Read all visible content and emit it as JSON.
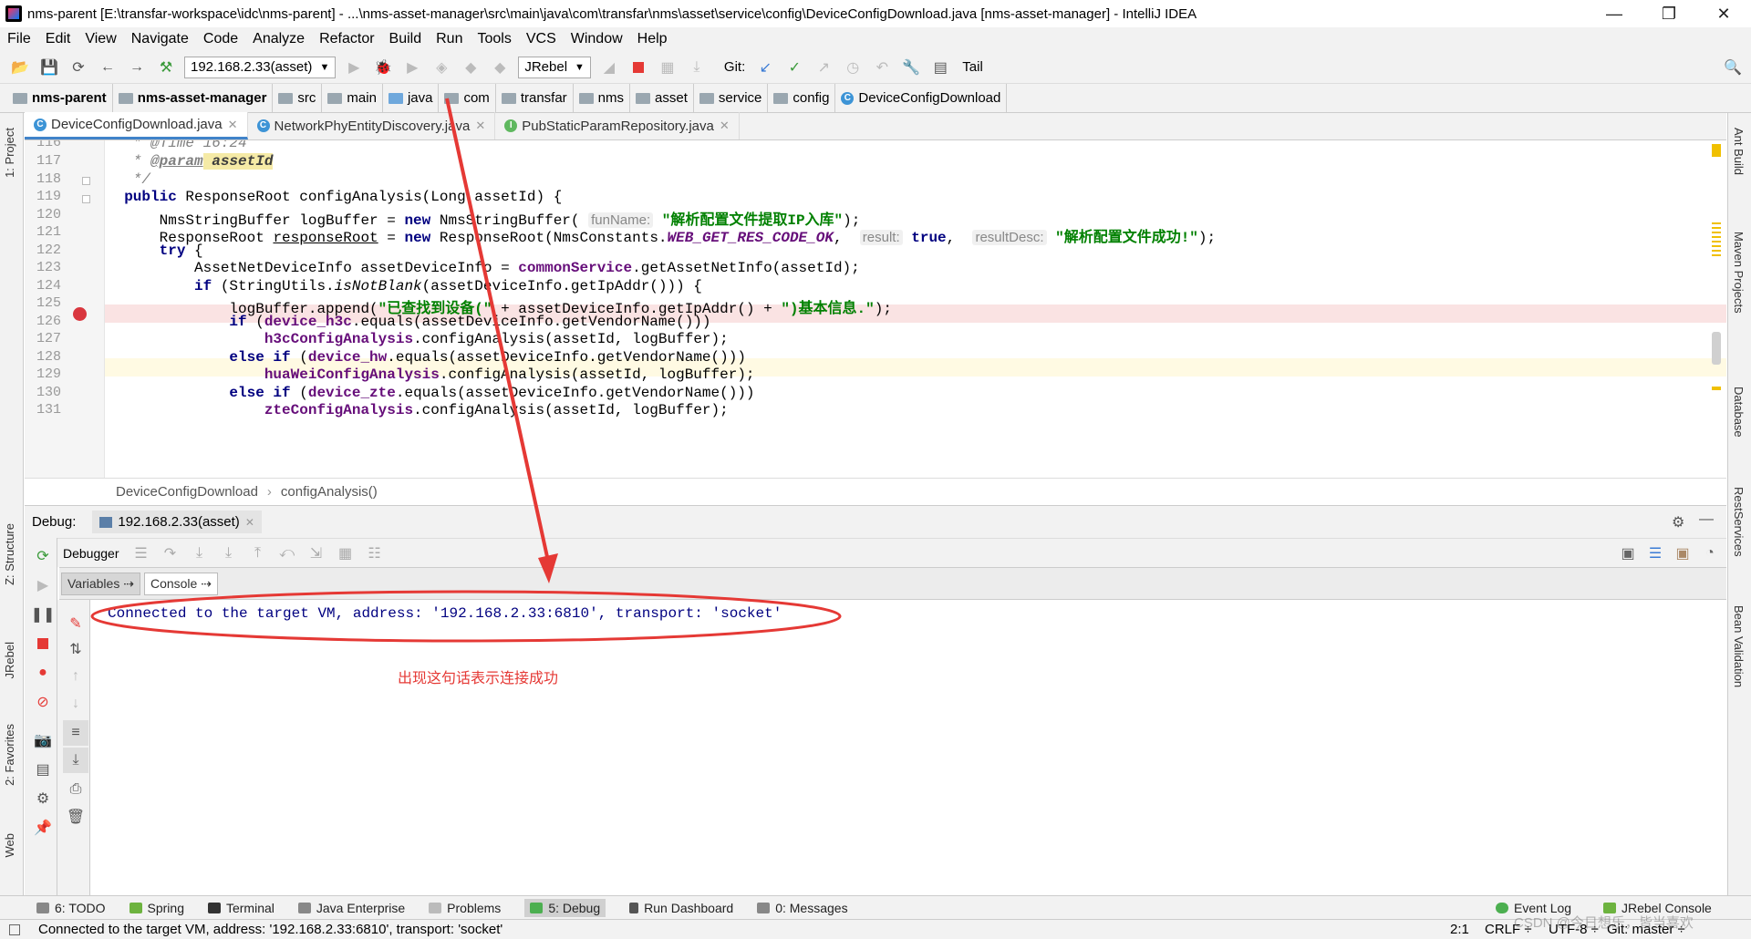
{
  "window": {
    "title": "nms-parent [E:\\transfar-workspace\\idc\\nms-parent] - ...\\nms-asset-manager\\src\\main\\java\\com\\transfar\\nms\\asset\\service\\config\\DeviceConfigDownload.java [nms-asset-manager] - IntelliJ IDEA",
    "minimize": "—",
    "maximize": "❐",
    "close": "✕"
  },
  "menu": [
    "File",
    "Edit",
    "View",
    "Navigate",
    "Code",
    "Analyze",
    "Refactor",
    "Build",
    "Run",
    "Tools",
    "VCS",
    "Window",
    "Help"
  ],
  "toolbar": {
    "run_config": "192.168.2.33(asset)",
    "jrebel": "JRebel",
    "git_label": "Git:",
    "tail": "Tail"
  },
  "nav": [
    "nms-parent",
    "nms-asset-manager",
    "src",
    "main",
    "java",
    "com",
    "transfar",
    "nms",
    "asset",
    "service",
    "config",
    "DeviceConfigDownload"
  ],
  "tabs": [
    "DeviceConfigDownload.java",
    "NetworkPhyEntityDiscovery.java",
    "PubStaticParamRepository.java"
  ],
  "code": {
    "line_numbers": [
      "116",
      "117",
      "118",
      "119",
      "120",
      "121",
      "122",
      "123",
      "124",
      "125",
      "126",
      "127",
      "128",
      "129",
      "130",
      "131"
    ],
    "l116": "   * @Time 16:24",
    "l117a": "   * ",
    "l117b": "@param",
    "l117c": " assetId",
    "l118": "   */",
    "l119a": "  public ",
    "l119b": "ResponseRoot configAnalysis(Long assetId) {",
    "l120a": "      NmsStringBuffer logBuffer = ",
    "l120b": "new",
    "l120c": " NmsStringBuffer( ",
    "l120hint": "funName:",
    "l120d": " \"解析配置文件提取IP入库\"",
    "l120e": ");",
    "l121a": "      ResponseRoot ",
    "l121b": "responseRoot",
    "l121c": " = ",
    "l121d": "new",
    "l121e": " ResponseRoot(NmsConstants.",
    "l121f": "WEB_GET_RES_CODE_OK",
    "l121g": ",  ",
    "l121hint1": "result:",
    "l121h": " true",
    "l121i": ",  ",
    "l121hint2": "resultDesc:",
    "l121j": " \"解析配置文件成功!\"",
    "l121k": ");",
    "l122a": "      ",
    "l122b": "try",
    "l122c": " {",
    "l123a": "          AssetNetDeviceInfo assetDeviceInfo = ",
    "l123b": "commonService",
    "l123c": ".getAssetNetInfo(assetId);",
    "l124a": "          ",
    "l124b": "if",
    "l124c": " (StringUtils.",
    "l124d": "isNotBlank",
    "l124e": "(assetDeviceInfo.getIpAddr())) {",
    "l125a": "              logBuffer.append(",
    "l125b": "\"已查找到设备(\"",
    "l125c": " + assetDeviceInfo.getIpAddr() + ",
    "l125d": "\")基本信息.\"",
    "l125e": ");",
    "l126a": "              ",
    "l126b": "if",
    "l126c": " (",
    "l126d": "device_h3c",
    "l126e": ".equals(assetDeviceInfo.getVendorName()))",
    "l127a": "                  ",
    "l127b": "h3cConfigAnalysis",
    "l127c": ".configAnalysis(assetId, logBuffer);",
    "l128a": "              ",
    "l128b": "else if",
    "l128c": " (",
    "l128d": "device_hw",
    "l128e": ".equals(assetDeviceInfo.getVendorName()))",
    "l129a": "                  ",
    "l129b": "huaWeiConfigAnalysis",
    "l129c": ".configAnalysis(assetId, logBuffer);",
    "l130a": "              ",
    "l130b": "else if",
    "l130c": " (",
    "l130d": "device_zte",
    "l130e": ".equals(assetDeviceInfo.getVendorName()))",
    "l131a": "                  ",
    "l131b": "zteConfigAnalysis",
    "l131c": ".configAnalysis(assetId, logBuffer);"
  },
  "editor_breadcrumb": [
    "DeviceConfigDownload",
    "configAnalysis()"
  ],
  "debug": {
    "label": "Debug:",
    "session": "192.168.2.33(asset)",
    "debugger_tab": "Debugger",
    "variables_tab": "Variables",
    "console_tab": "Console",
    "console_line": "Connected to the target VM, address: '192.168.2.33:6810', transport: 'socket'",
    "annotation": "出现这句话表示连接成功"
  },
  "left_tools": [
    "1: Project",
    "Z: Structure",
    "JRebel",
    "2: Favorites",
    "Web"
  ],
  "right_tools": [
    "Ant Build",
    "Maven Projects",
    "Database",
    "RestServices",
    "Bean Validation"
  ],
  "bottom_tools": [
    "6: TODO",
    "Spring",
    "Terminal",
    "Java Enterprise",
    "Problems",
    "5: Debug",
    "Run Dashboard",
    "0: Messages"
  ],
  "bottom_right": [
    "Event Log",
    "JRebel Console"
  ],
  "status": {
    "message": "Connected to the target VM, address: '192.168.2.33:6810', transport: 'socket'",
    "position": "2:1",
    "line_sep": "CRLF ÷",
    "encoding": "UTF-8 ÷",
    "git": "Git: master ÷",
    "watermark": "CSDN @今日想乐，皆当喜欢"
  },
  "colors": {
    "annotation_red": "#e53935",
    "keyword": "#000080",
    "string": "#008000",
    "field": "#660e7a"
  }
}
